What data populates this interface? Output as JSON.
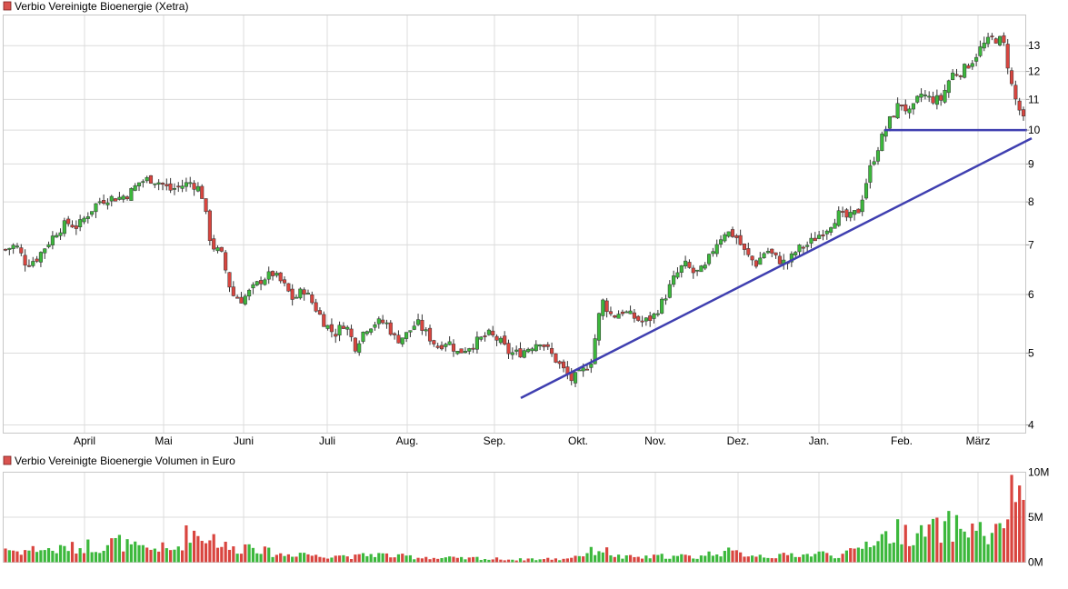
{
  "chart_data": [
    {
      "type": "candlestick",
      "title": "Verbio Vereinigte Bioenergie (Xetra)",
      "legend_color": "#d9534f",
      "y_scale": "log",
      "ylim": [
        3.9,
        14.3
      ],
      "y_ticks": [
        4,
        5,
        6,
        7,
        8,
        9,
        10,
        11,
        12,
        13
      ],
      "x_months": [
        "April",
        "Mai",
        "Juni",
        "Juli",
        "Aug.",
        "Sep.",
        "Okt.",
        "Nov.",
        "Dez.",
        "Jan.",
        "Feb.",
        "März"
      ],
      "grid": true,
      "up_color": "#3cb83c",
      "down_color": "#d9453f",
      "close_series_anchors": [
        6.9,
        7.0,
        6.6,
        6.7,
        7.0,
        7.3,
        7.5,
        7.4,
        7.7,
        8.0,
        8.1,
        8.1,
        8.2,
        8.5,
        8.6,
        8.5,
        8.3,
        8.4,
        8.5,
        8.3,
        7.0,
        6.8,
        6.0,
        5.9,
        6.1,
        6.3,
        6.4,
        6.2,
        5.9,
        6.1,
        5.8,
        5.5,
        5.3,
        5.5,
        5.1,
        5.4,
        5.5,
        5.5,
        5.2,
        5.3,
        5.5,
        5.3,
        5.1,
        5.2,
        5.0,
        5.1,
        5.2,
        5.3,
        5.2,
        5.0,
        5.0,
        5.1,
        5.2,
        5.0,
        4.8,
        4.6,
        4.7,
        4.9,
        5.9,
        5.6,
        5.7,
        5.6,
        5.5,
        5.6,
        5.9,
        6.3,
        6.6,
        6.4,
        6.5,
        7.0,
        7.3,
        7.2,
        6.8,
        6.6,
        6.9,
        6.7,
        6.6,
        6.9,
        7.0,
        7.2,
        7.4,
        7.7,
        7.6,
        7.8,
        8.8,
        9.6,
        10.3,
        10.9,
        10.5,
        11.2,
        11.0,
        11.0,
        11.9,
        12.0,
        12.4,
        13.0,
        13.3,
        13.2,
        11.2,
        10.3
      ],
      "support_line": {
        "from": [
          "Sep. 15",
          4.35
        ],
        "to": [
          "März 25",
          9.75
        ]
      },
      "horizontal_line": {
        "level": 10.0,
        "from": "Jan. 25",
        "to": "März 25"
      },
      "line_color": "#3f3fb0"
    },
    {
      "type": "bar",
      "title": "Verbio Vereinigte Bioenergie Volumen in Euro",
      "legend_color": "#d9534f",
      "ylim": [
        0,
        10000000
      ],
      "y_ticks": [
        "0M",
        "5M",
        "10M"
      ],
      "grid": true,
      "volume_anchors_m": [
        1.6,
        1.2,
        1.3,
        1.5,
        1.4,
        1.3,
        1.7,
        1.5,
        1.9,
        1.6,
        2.1,
        2.3,
        1.8,
        1.5,
        1.4,
        1.7,
        1.2,
        1.9,
        3.8,
        2.6,
        3.1,
        2.0,
        1.4,
        1.6,
        2.2,
        1.3,
        1.0,
        0.8,
        0.9,
        1.1,
        0.7,
        0.6,
        0.9,
        0.7,
        0.6,
        0.8,
        0.9,
        0.8,
        0.6,
        0.7,
        0.5,
        0.6,
        0.4,
        0.5,
        0.4,
        0.4,
        0.5,
        0.3,
        0.4,
        0.3,
        0.3,
        0.4,
        0.3,
        0.4,
        0.3,
        0.6,
        0.8,
        1.2,
        1.5,
        0.9,
        0.5,
        0.6,
        0.5,
        0.6,
        0.7,
        0.6,
        0.7,
        0.5,
        0.8,
        1.1,
        1.2,
        1.0,
        0.9,
        0.8,
        0.7,
        0.6,
        0.8,
        0.9,
        0.8,
        1.0,
        0.9,
        0.7,
        1.0,
        1.5,
        2.4,
        2.7,
        3.0,
        3.5,
        3.2,
        2.9,
        3.8,
        3.3,
        4.2,
        3.6,
        3.9,
        3.4,
        2.5,
        4.4,
        8.0,
        8.6
      ]
    }
  ]
}
